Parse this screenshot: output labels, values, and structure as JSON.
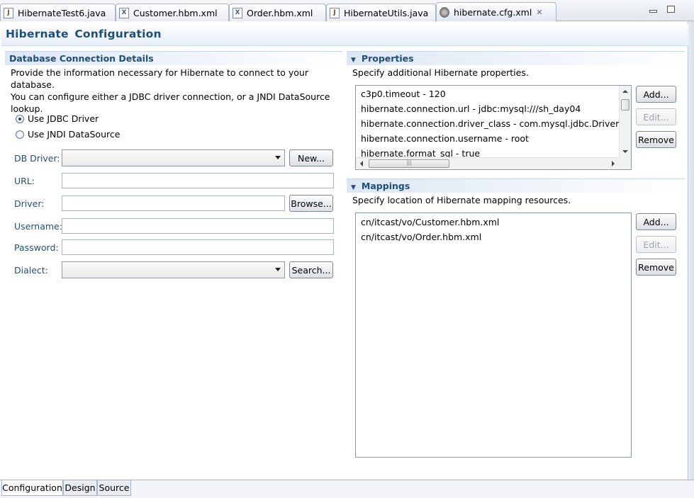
{
  "editor_tabs": [
    {
      "label": "HibernateTest6.java",
      "icon": "java-file-icon"
    },
    {
      "label": "Customer.hbm.xml",
      "icon": "xml-file-icon"
    },
    {
      "label": "Order.hbm.xml",
      "icon": "xml-file-icon"
    },
    {
      "label": "HibernateUtils.java",
      "icon": "java-file-icon"
    },
    {
      "label": "hibernate.cfg.xml",
      "icon": "hibernate-file-icon",
      "active": true
    }
  ],
  "page": {
    "title": "Hibernate  Configuration"
  },
  "db_section": {
    "title": "Database Connection Details",
    "description_line1": "Provide the information necessary for Hibernate to connect to your database.",
    "description_line2": "You can configure either a JDBC driver connection, or a JNDI DataSource",
    "description_line3": "lookup.",
    "radio_jdbc": "Use JDBC Driver",
    "radio_jndi": "Use JNDI DataSource",
    "selected": "jdbc",
    "labels": {
      "db_driver": "DB Driver:",
      "url": "URL:",
      "driver": "Driver:",
      "username": "Username:",
      "password": "Password:",
      "dialect": "Dialect:"
    },
    "values": {
      "db_driver": "",
      "url": "",
      "driver": "",
      "username": "",
      "password": "",
      "dialect": ""
    },
    "buttons": {
      "new": "New...",
      "browse": "Browse...",
      "search": "Search..."
    }
  },
  "properties_section": {
    "title": "Properties",
    "description": "Specify additional Hibernate properties.",
    "items": [
      "c3p0.timeout - 120",
      "hibernate.connection.url - jdbc:mysql:///sh_day04",
      "hibernate.connection.driver_class - com.mysql.jdbc.Driver",
      "hibernate.connection.username - root",
      "hibernate.format_sql - true"
    ],
    "buttons": {
      "add": "Add...",
      "edit": "Edit...",
      "remove": "Remove"
    }
  },
  "mappings_section": {
    "title": "Mappings",
    "description": "Specify location of Hibernate mapping resources.",
    "items": [
      "cn/itcast/vo/Customer.hbm.xml",
      "cn/itcast/vo/Order.hbm.xml"
    ],
    "buttons": {
      "add": "Add...",
      "edit": "Edit...",
      "remove": "Remove"
    }
  },
  "bottom_tabs": [
    {
      "label": "Configuration",
      "active": true
    },
    {
      "label": "Design"
    },
    {
      "label": "Source"
    }
  ]
}
